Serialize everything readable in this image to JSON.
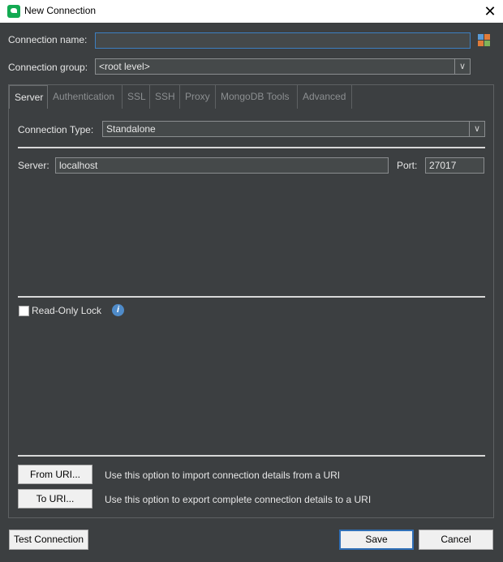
{
  "window": {
    "title": "New Connection",
    "close_icon": "close-icon"
  },
  "connection": {
    "name_label": "Connection name:",
    "name_value": "",
    "group_label": "Connection group:",
    "group_value": "<root level>"
  },
  "tabs": [
    {
      "label": "Server",
      "active": true
    },
    {
      "label": "Authentication",
      "active": false
    },
    {
      "label": "SSL",
      "active": false
    },
    {
      "label": "SSH",
      "active": false
    },
    {
      "label": "Proxy",
      "active": false
    },
    {
      "label": "MongoDB Tools",
      "active": false
    },
    {
      "label": "Advanced",
      "active": false
    }
  ],
  "server": {
    "type_label": "Connection Type:",
    "type_value": "Standalone",
    "server_label": "Server:",
    "server_value": "localhost",
    "port_label": "Port:",
    "port_value": "27017",
    "readonly_label": "Read-Only Lock",
    "readonly_checked": false
  },
  "uri": {
    "from_button": "From URI...",
    "from_desc": "Use this option to import connection details from a URI",
    "to_button": "To URI...",
    "to_desc": "Use this option to export complete connection details to a URI"
  },
  "footer": {
    "test_button": "Test Connection",
    "save_button": "Save",
    "cancel_button": "Cancel"
  },
  "colors": {
    "background": "#3c3f41",
    "accent": "#3d7fc1",
    "brand": "#13aa52"
  }
}
